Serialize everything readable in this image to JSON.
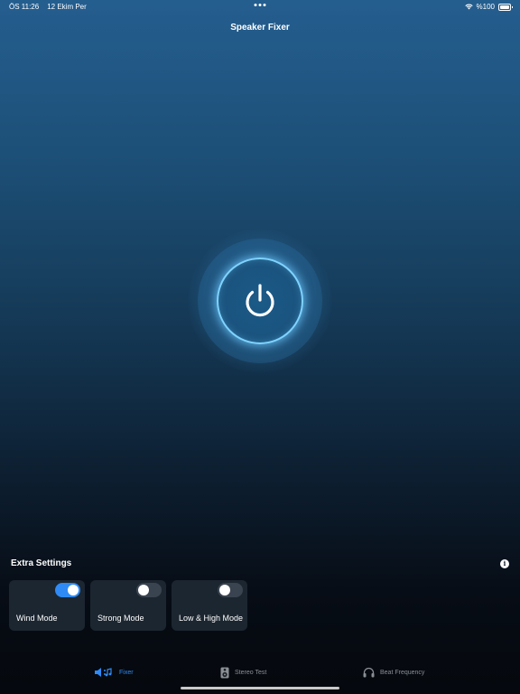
{
  "status_bar": {
    "time": "ÖS 11:26",
    "date": "12 Ekim Per",
    "battery": "%100",
    "icons": [
      "wifi-icon",
      "battery-icon"
    ]
  },
  "nav": {
    "title": "Speaker Fixer"
  },
  "power_button": {
    "icon": "power-icon",
    "accent_color": "#7fd3ff"
  },
  "extra_settings": {
    "title": "Extra Settings",
    "info_icon": "i",
    "modes": [
      {
        "label": "Wind Mode",
        "enabled": true
      },
      {
        "label": "Strong Mode",
        "enabled": false
      },
      {
        "label": "Low & High Mode",
        "enabled": false
      }
    ]
  },
  "tabs": [
    {
      "label": "Fixer",
      "icon": "speaker-icon",
      "active": true
    },
    {
      "label": "Stereo Test",
      "icon": "speaker-box-icon",
      "active": false
    },
    {
      "label": "Beat Frequency",
      "icon": "headphones-icon",
      "active": false
    }
  ],
  "colors": {
    "accent": "#2f8af5",
    "inactive_tab": "#8a8f96",
    "card_bg": "#1c2630"
  }
}
